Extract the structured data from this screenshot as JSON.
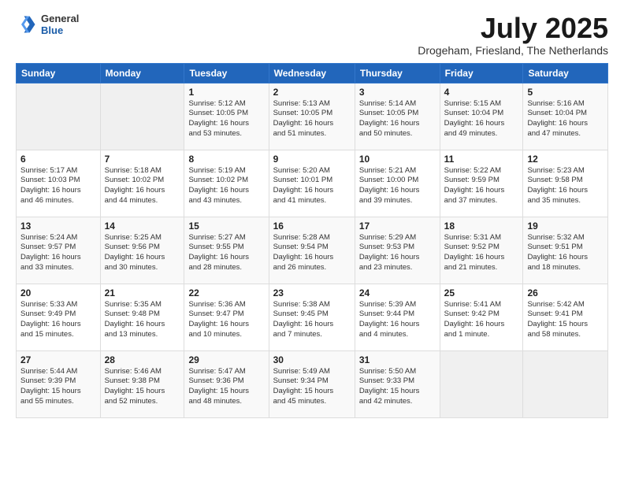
{
  "logo": {
    "general": "General",
    "blue": "Blue"
  },
  "header": {
    "month": "July 2025",
    "location": "Drogeham, Friesland, The Netherlands"
  },
  "weekdays": [
    "Sunday",
    "Monday",
    "Tuesday",
    "Wednesday",
    "Thursday",
    "Friday",
    "Saturday"
  ],
  "weeks": [
    [
      {
        "day": "",
        "content": ""
      },
      {
        "day": "",
        "content": ""
      },
      {
        "day": "1",
        "content": "Sunrise: 5:12 AM\nSunset: 10:05 PM\nDaylight: 16 hours\nand 53 minutes."
      },
      {
        "day": "2",
        "content": "Sunrise: 5:13 AM\nSunset: 10:05 PM\nDaylight: 16 hours\nand 51 minutes."
      },
      {
        "day": "3",
        "content": "Sunrise: 5:14 AM\nSunset: 10:05 PM\nDaylight: 16 hours\nand 50 minutes."
      },
      {
        "day": "4",
        "content": "Sunrise: 5:15 AM\nSunset: 10:04 PM\nDaylight: 16 hours\nand 49 minutes."
      },
      {
        "day": "5",
        "content": "Sunrise: 5:16 AM\nSunset: 10:04 PM\nDaylight: 16 hours\nand 47 minutes."
      }
    ],
    [
      {
        "day": "6",
        "content": "Sunrise: 5:17 AM\nSunset: 10:03 PM\nDaylight: 16 hours\nand 46 minutes."
      },
      {
        "day": "7",
        "content": "Sunrise: 5:18 AM\nSunset: 10:02 PM\nDaylight: 16 hours\nand 44 minutes."
      },
      {
        "day": "8",
        "content": "Sunrise: 5:19 AM\nSunset: 10:02 PM\nDaylight: 16 hours\nand 43 minutes."
      },
      {
        "day": "9",
        "content": "Sunrise: 5:20 AM\nSunset: 10:01 PM\nDaylight: 16 hours\nand 41 minutes."
      },
      {
        "day": "10",
        "content": "Sunrise: 5:21 AM\nSunset: 10:00 PM\nDaylight: 16 hours\nand 39 minutes."
      },
      {
        "day": "11",
        "content": "Sunrise: 5:22 AM\nSunset: 9:59 PM\nDaylight: 16 hours\nand 37 minutes."
      },
      {
        "day": "12",
        "content": "Sunrise: 5:23 AM\nSunset: 9:58 PM\nDaylight: 16 hours\nand 35 minutes."
      }
    ],
    [
      {
        "day": "13",
        "content": "Sunrise: 5:24 AM\nSunset: 9:57 PM\nDaylight: 16 hours\nand 33 minutes."
      },
      {
        "day": "14",
        "content": "Sunrise: 5:25 AM\nSunset: 9:56 PM\nDaylight: 16 hours\nand 30 minutes."
      },
      {
        "day": "15",
        "content": "Sunrise: 5:27 AM\nSunset: 9:55 PM\nDaylight: 16 hours\nand 28 minutes."
      },
      {
        "day": "16",
        "content": "Sunrise: 5:28 AM\nSunset: 9:54 PM\nDaylight: 16 hours\nand 26 minutes."
      },
      {
        "day": "17",
        "content": "Sunrise: 5:29 AM\nSunset: 9:53 PM\nDaylight: 16 hours\nand 23 minutes."
      },
      {
        "day": "18",
        "content": "Sunrise: 5:31 AM\nSunset: 9:52 PM\nDaylight: 16 hours\nand 21 minutes."
      },
      {
        "day": "19",
        "content": "Sunrise: 5:32 AM\nSunset: 9:51 PM\nDaylight: 16 hours\nand 18 minutes."
      }
    ],
    [
      {
        "day": "20",
        "content": "Sunrise: 5:33 AM\nSunset: 9:49 PM\nDaylight: 16 hours\nand 15 minutes."
      },
      {
        "day": "21",
        "content": "Sunrise: 5:35 AM\nSunset: 9:48 PM\nDaylight: 16 hours\nand 13 minutes."
      },
      {
        "day": "22",
        "content": "Sunrise: 5:36 AM\nSunset: 9:47 PM\nDaylight: 16 hours\nand 10 minutes."
      },
      {
        "day": "23",
        "content": "Sunrise: 5:38 AM\nSunset: 9:45 PM\nDaylight: 16 hours\nand 7 minutes."
      },
      {
        "day": "24",
        "content": "Sunrise: 5:39 AM\nSunset: 9:44 PM\nDaylight: 16 hours\nand 4 minutes."
      },
      {
        "day": "25",
        "content": "Sunrise: 5:41 AM\nSunset: 9:42 PM\nDaylight: 16 hours\nand 1 minute."
      },
      {
        "day": "26",
        "content": "Sunrise: 5:42 AM\nSunset: 9:41 PM\nDaylight: 15 hours\nand 58 minutes."
      }
    ],
    [
      {
        "day": "27",
        "content": "Sunrise: 5:44 AM\nSunset: 9:39 PM\nDaylight: 15 hours\nand 55 minutes."
      },
      {
        "day": "28",
        "content": "Sunrise: 5:46 AM\nSunset: 9:38 PM\nDaylight: 15 hours\nand 52 minutes."
      },
      {
        "day": "29",
        "content": "Sunrise: 5:47 AM\nSunset: 9:36 PM\nDaylight: 15 hours\nand 48 minutes."
      },
      {
        "day": "30",
        "content": "Sunrise: 5:49 AM\nSunset: 9:34 PM\nDaylight: 15 hours\nand 45 minutes."
      },
      {
        "day": "31",
        "content": "Sunrise: 5:50 AM\nSunset: 9:33 PM\nDaylight: 15 hours\nand 42 minutes."
      },
      {
        "day": "",
        "content": ""
      },
      {
        "day": "",
        "content": ""
      }
    ]
  ]
}
